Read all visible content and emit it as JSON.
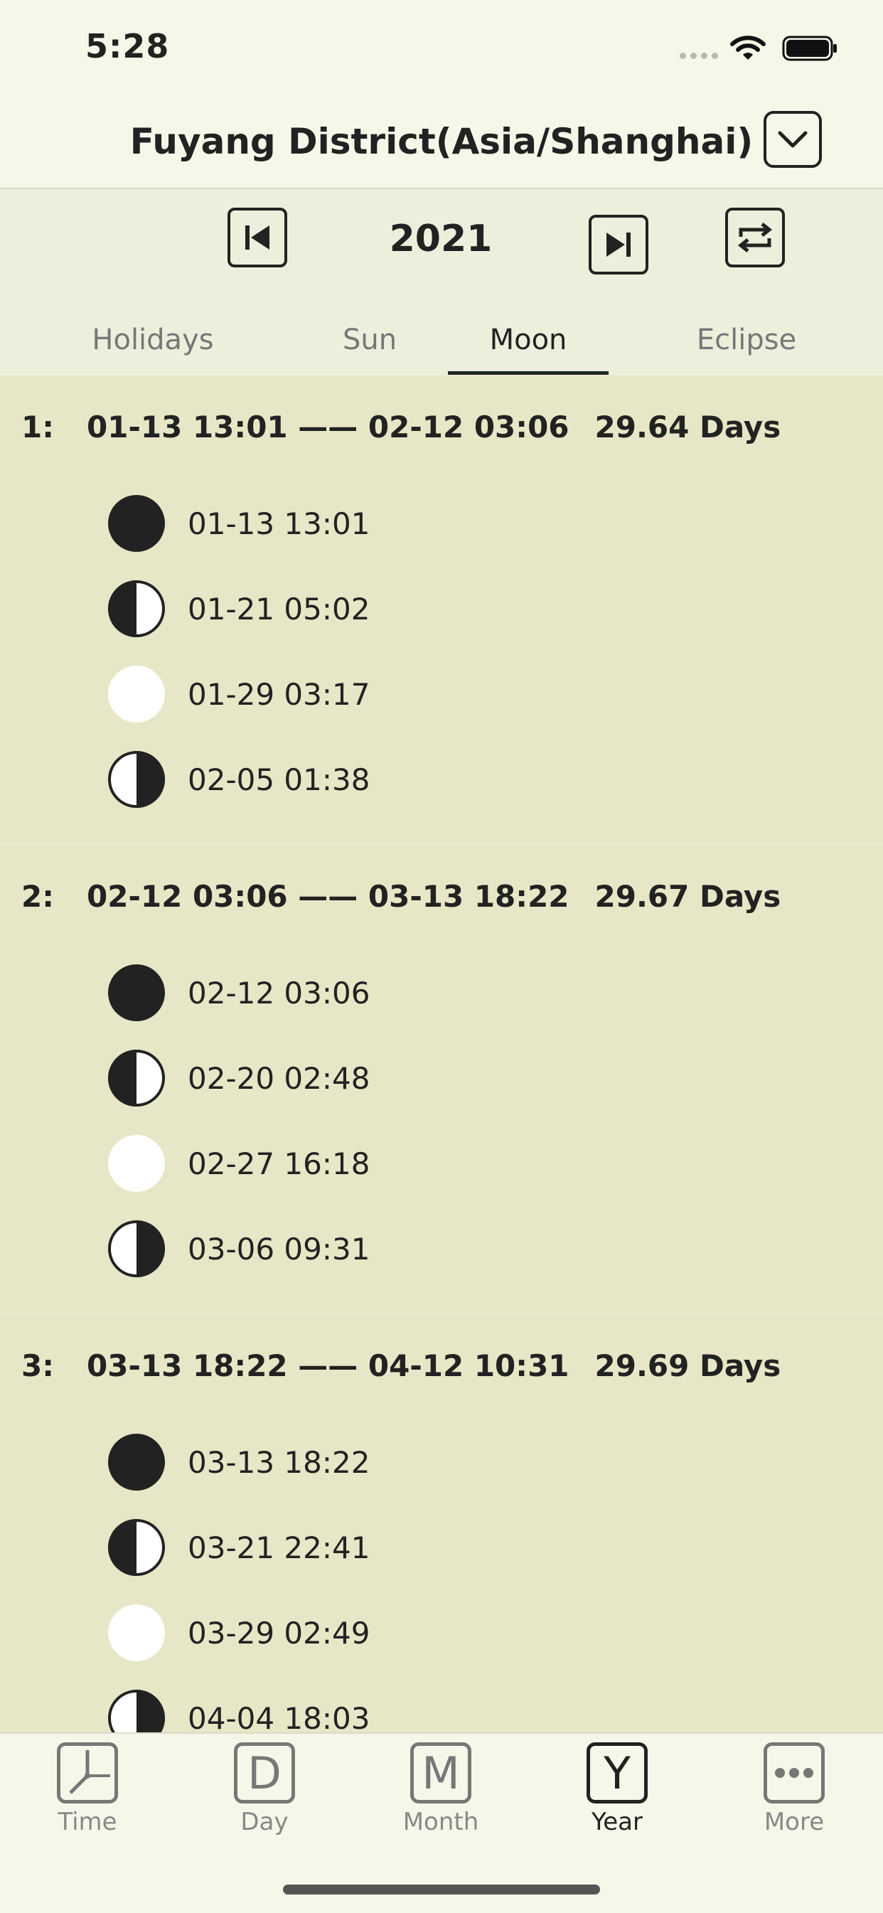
{
  "status_bar": {
    "time": "5:28"
  },
  "header": {
    "title": "Fuyang District(Asia/Shanghai)"
  },
  "toolbar": {
    "year": "2021"
  },
  "tabs": [
    {
      "label": "Holidays",
      "active": false
    },
    {
      "label": "Sun",
      "active": false
    },
    {
      "label": "Moon",
      "active": true
    },
    {
      "label": "Eclipse",
      "active": false
    }
  ],
  "lunar_periods": [
    {
      "index": "1:",
      "range": "01-13 13:01 —— 02-12 03:06",
      "duration": "29.64 Days",
      "phases": [
        {
          "phase": "new-moon",
          "time": "01-13 13:01"
        },
        {
          "phase": "first-quarter",
          "time": "01-21 05:02"
        },
        {
          "phase": "full-moon",
          "time": "01-29 03:17"
        },
        {
          "phase": "last-quarter",
          "time": "02-05 01:38"
        }
      ]
    },
    {
      "index": "2:",
      "range": "02-12 03:06 —— 03-13 18:22",
      "duration": "29.67 Days",
      "phases": [
        {
          "phase": "new-moon",
          "time": "02-12 03:06"
        },
        {
          "phase": "first-quarter",
          "time": "02-20 02:48"
        },
        {
          "phase": "full-moon",
          "time": "02-27 16:18"
        },
        {
          "phase": "last-quarter",
          "time": "03-06 09:31"
        }
      ]
    },
    {
      "index": "3:",
      "range": "03-13 18:22 —— 04-12 10:31",
      "duration": "29.69 Days",
      "phases": [
        {
          "phase": "new-moon",
          "time": "03-13 18:22"
        },
        {
          "phase": "first-quarter",
          "time": "03-21 22:41"
        },
        {
          "phase": "full-moon",
          "time": "03-29 02:49"
        },
        {
          "phase": "last-quarter",
          "time": "04-04 18:03"
        }
      ]
    }
  ],
  "tabbar": [
    {
      "label": "Time",
      "icon": "clock-icon",
      "active": false
    },
    {
      "label": "Day",
      "icon": "D",
      "active": false
    },
    {
      "label": "Month",
      "icon": "M",
      "active": false
    },
    {
      "label": "Year",
      "icon": "Y",
      "active": true
    },
    {
      "label": "More",
      "icon": "more-icon",
      "active": false
    }
  ],
  "colors": {
    "background": "#e7e6c6",
    "header": "#f7f7e9",
    "ink": "#222222",
    "muted": "#777777"
  }
}
